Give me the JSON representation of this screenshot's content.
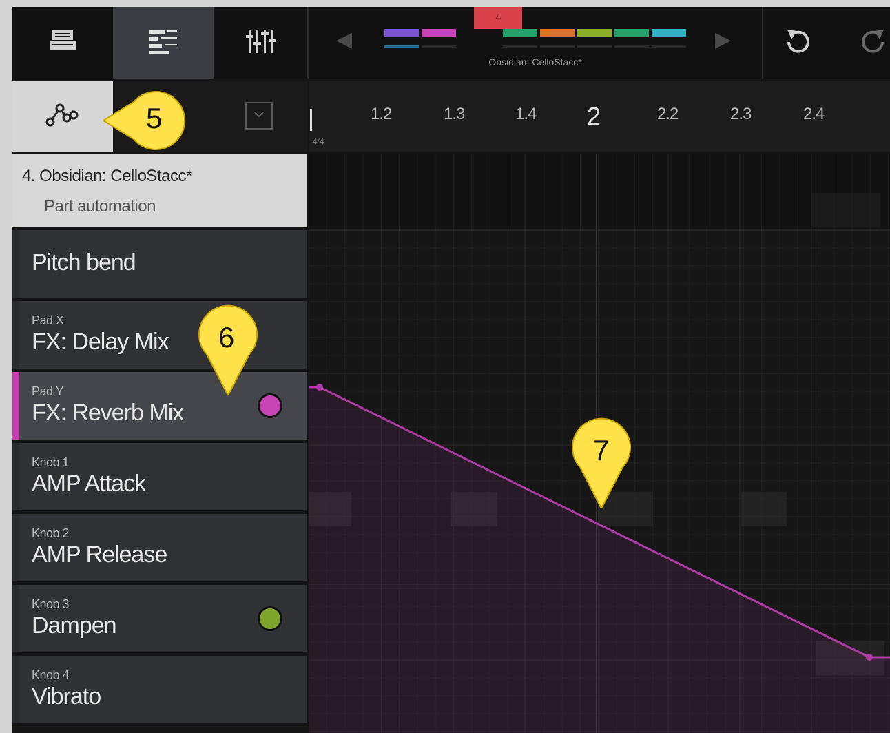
{
  "toolbar": {
    "icons": [
      "parts-icon",
      "arranger-icon",
      "mixer-icon"
    ],
    "active_index": 1,
    "segment_colors": [
      "#7b55d6",
      "#c744b4",
      "#d9424b",
      "#21a36b",
      "#e0722b",
      "#8fb12a",
      "#21a36b",
      "#2fb2c2"
    ],
    "selected_segment_label": "4",
    "track_name": "Obsidian: CelloStacc*",
    "undo_icon": "undo-icon",
    "redo_icon": "redo-icon"
  },
  "ruler": {
    "ticks": [
      "1.2",
      "1.3",
      "1.4",
      "2",
      "2.2",
      "2.3",
      "2.4"
    ],
    "time_signature": "4/4"
  },
  "track_header": {
    "title": "4. Obsidian: CelloStacc*",
    "subtitle": "Part automation"
  },
  "params": [
    {
      "small": "",
      "big": "Pitch bend",
      "dot": null,
      "selected": false
    },
    {
      "small": "Pad X",
      "big": "FX: Delay Mix",
      "dot": null,
      "selected": false
    },
    {
      "small": "Pad Y",
      "big": "FX: Reverb Mix",
      "dot": "#c744b4",
      "selected": true
    },
    {
      "small": "Knob 1",
      "big": "AMP Attack",
      "dot": null,
      "selected": false
    },
    {
      "small": "Knob 2",
      "big": "AMP Release",
      "dot": null,
      "selected": false
    },
    {
      "small": "Knob 3",
      "big": "Dampen",
      "dot": "#7ea52b",
      "selected": false
    },
    {
      "small": "Knob 4",
      "big": "Vibrato",
      "dot": null,
      "selected": false
    }
  ],
  "automation": {
    "color": "#b03ba6",
    "start_value": 1.0,
    "end_value": 0.0
  },
  "callouts": {
    "c5": "5",
    "c6": "6",
    "c7": "7"
  }
}
